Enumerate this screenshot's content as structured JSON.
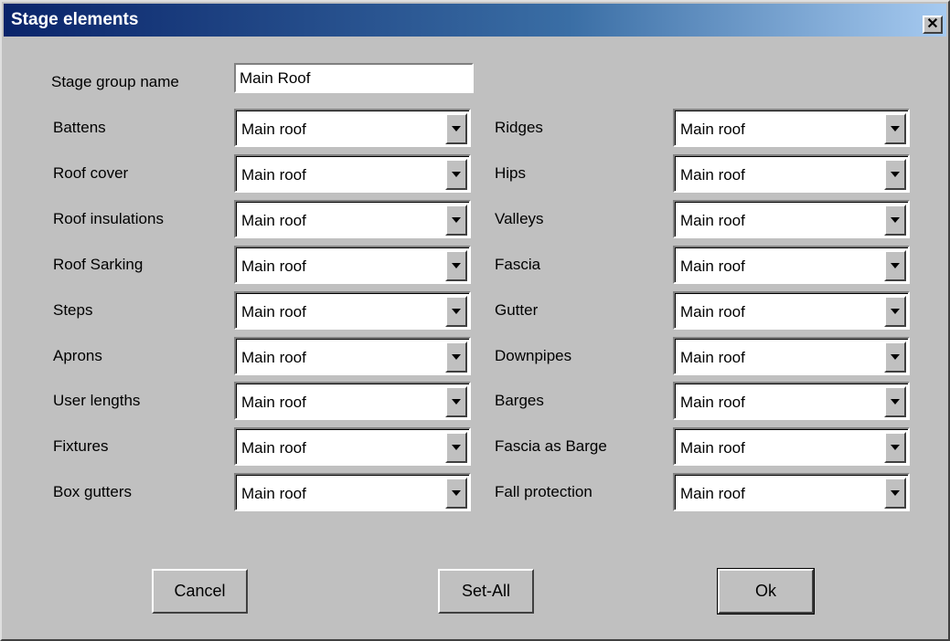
{
  "window": {
    "title": "Stage elements",
    "close_glyph": "✕",
    "close_icon": "close-icon"
  },
  "group": {
    "label": "Stage group name",
    "value": "Main Roof"
  },
  "left_fields": [
    {
      "label": "Battens",
      "value": "Main roof"
    },
    {
      "label": "Roof cover",
      "value": "Main roof"
    },
    {
      "label": "Roof insulations",
      "value": "Main roof"
    },
    {
      "label": "Roof Sarking",
      "value": "Main roof"
    },
    {
      "label": "Steps",
      "value": "Main roof"
    },
    {
      "label": "Aprons",
      "value": "Main roof"
    },
    {
      "label": "User lengths",
      "value": "Main roof"
    },
    {
      "label": "Fixtures",
      "value": "Main roof"
    },
    {
      "label": "Box gutters",
      "value": "Main roof"
    }
  ],
  "right_fields": [
    {
      "label": "Ridges",
      "value": "Main roof"
    },
    {
      "label": "Hips",
      "value": "Main roof"
    },
    {
      "label": "Valleys",
      "value": "Main roof"
    },
    {
      "label": "Fascia",
      "value": "Main roof"
    },
    {
      "label": "Gutter",
      "value": "Main roof"
    },
    {
      "label": "Downpipes",
      "value": "Main roof"
    },
    {
      "label": "Barges",
      "value": "Main roof"
    },
    {
      "label": "Fascia as Barge",
      "value": "Main roof"
    },
    {
      "label": "Fall protection",
      "value": "Main roof"
    }
  ],
  "buttons": {
    "cancel": "Cancel",
    "set_all": "Set-All",
    "ok": "Ok"
  }
}
